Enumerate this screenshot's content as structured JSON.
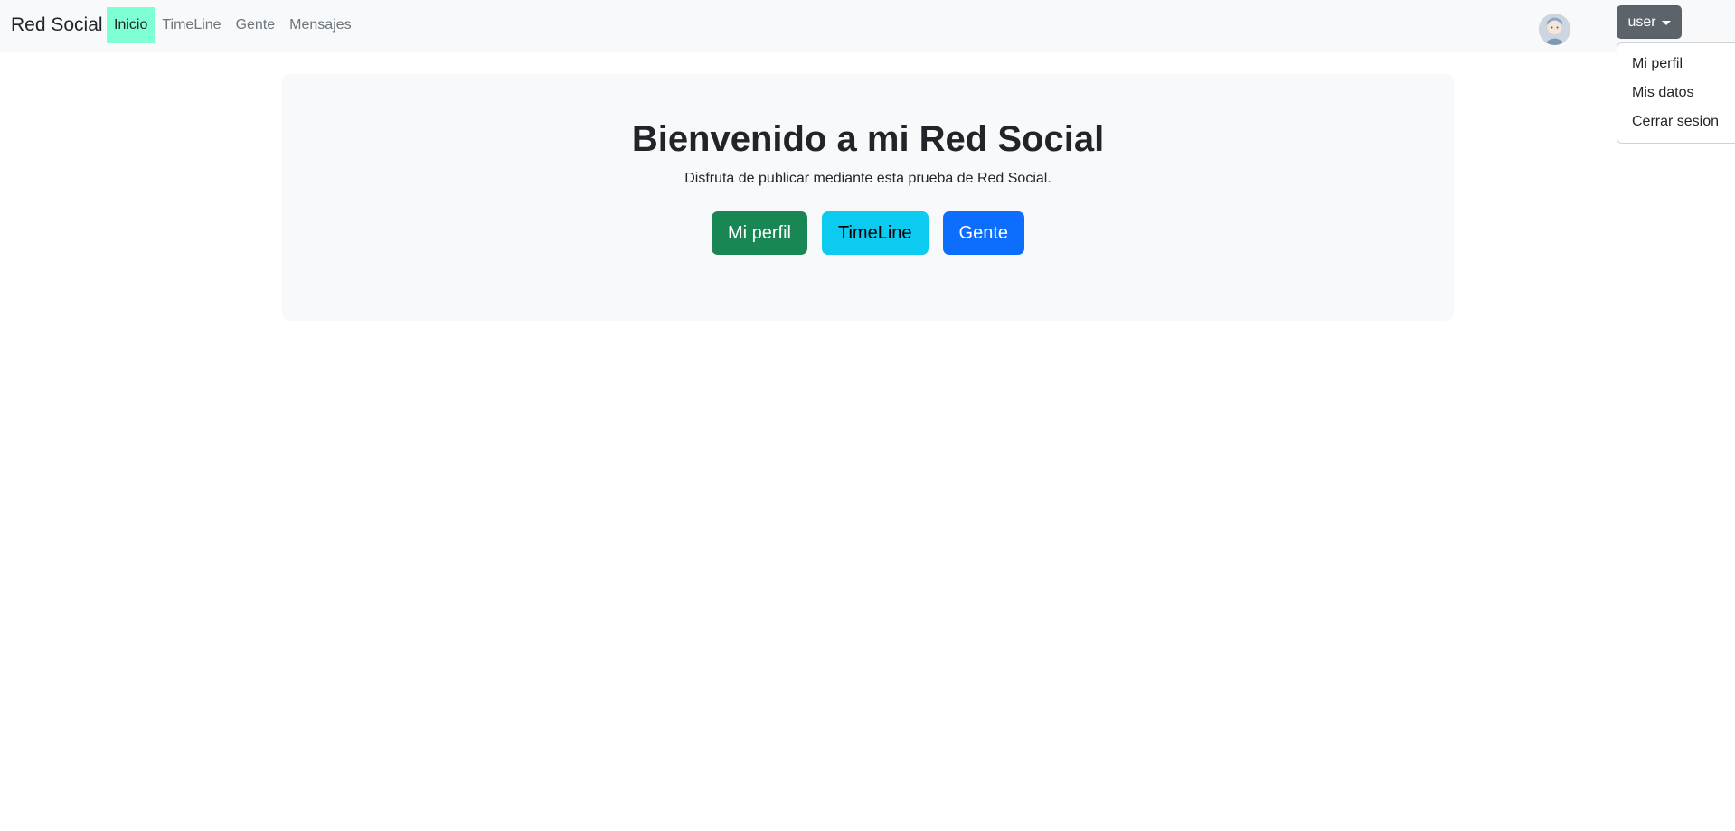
{
  "navbar": {
    "brand": "Red Social",
    "links": [
      {
        "label": "Inicio",
        "active": true
      },
      {
        "label": "TimeLine",
        "active": false
      },
      {
        "label": "Gente",
        "active": false
      },
      {
        "label": "Mensajes",
        "active": false
      }
    ],
    "avatar_icon": "user-avatar-icon",
    "user_button": "user",
    "active_color": "#7fffd4"
  },
  "dropdown": {
    "items": [
      "Mi perfil",
      "Mis datos",
      "Cerrar sesion"
    ]
  },
  "hero": {
    "title": "Bienvenido a mi Red Social",
    "subtitle": "Disfruta de publicar mediante esta prueba de Red Social.",
    "buttons": [
      {
        "label": "Mi perfil",
        "color": "#198754"
      },
      {
        "label": "TimeLine",
        "color": "#0dcaf0"
      },
      {
        "label": "Gente",
        "color": "#0d6efd"
      }
    ]
  }
}
